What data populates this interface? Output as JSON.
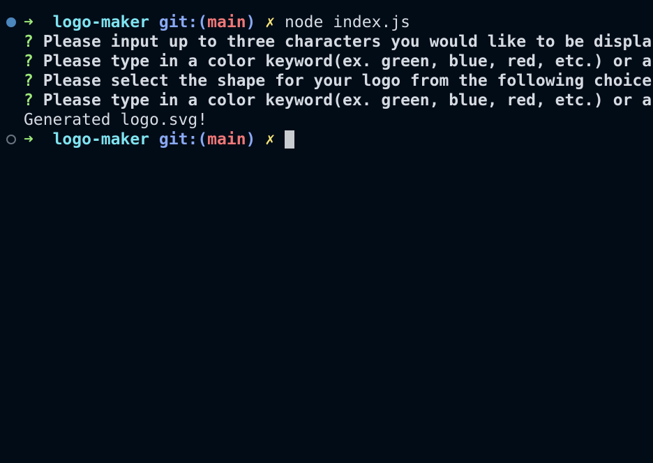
{
  "colors": {
    "background": "#020c17",
    "arrow": "#9de87a",
    "directory": "#7fe3f0",
    "git": "#8aa9f5",
    "branch": "#f07878",
    "dirty": "#f5e37a",
    "text": "#d6dbe2"
  },
  "session": {
    "prompt1": {
      "marker_icon": "filled-circle-icon",
      "arrow": "➜",
      "directory": "logo-maker",
      "git_open": "git:(",
      "branch": "main",
      "git_close": ")",
      "dirty": "✗",
      "command": "node index.js"
    },
    "questions": [
      {
        "mark": "?",
        "text": "Please input up to three characters you would like to be displa"
      },
      {
        "mark": "?",
        "text": "Please type in a color keyword(ex. green, blue, red, etc.) or a"
      },
      {
        "mark": "?",
        "text": "Please select the shape for your logo from the following choice"
      },
      {
        "mark": "?",
        "text": "Please type in a color keyword(ex. green, blue, red, etc.) or a"
      }
    ],
    "output": "Generated logo.svg!",
    "prompt2": {
      "marker_icon": "hollow-circle-icon",
      "arrow": "➜",
      "directory": "logo-maker",
      "git_open": "git:(",
      "branch": "main",
      "git_close": ")",
      "dirty": "✗"
    }
  }
}
